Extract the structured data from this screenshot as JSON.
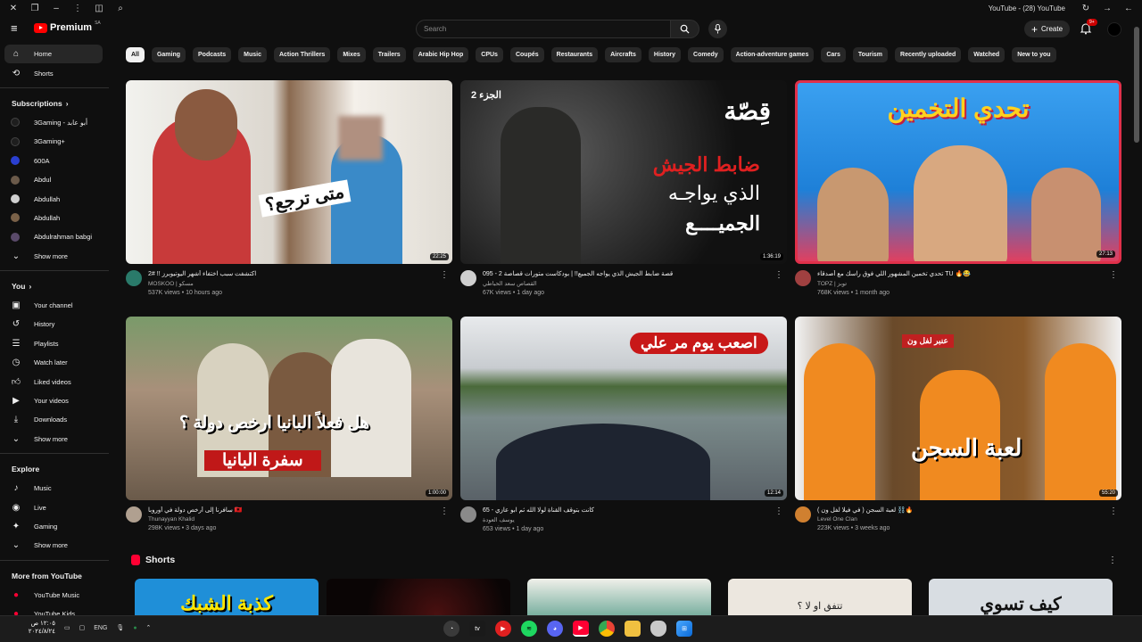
{
  "browser": {
    "title": "YouTube - (28) YouTube"
  },
  "masthead": {
    "logo_text": "Premium",
    "logo_sup": "SA",
    "search_placeholder": "Search",
    "create_label": "Create",
    "notif_count": "9+"
  },
  "sidebar": {
    "main": [
      {
        "label": "Home",
        "icon": "home-icon"
      },
      {
        "label": "Shorts",
        "icon": "shorts-icon"
      }
    ],
    "subscriptions_title": "Subscriptions",
    "subscriptions": [
      {
        "label": "3Gaming - أبو عابد",
        "color": "#1e1e1e"
      },
      {
        "label": "3Gaming+",
        "color": "#1e1e1e"
      },
      {
        "label": "600A",
        "color": "#2a3fd0"
      },
      {
        "label": "Abdul",
        "color": "#6b5a4a"
      },
      {
        "label": "Abdullah",
        "color": "#d0d0d0"
      },
      {
        "label": "Abdullah",
        "color": "#7a6148"
      },
      {
        "label": "Abdulrahman babgi",
        "color": "#5a4a6a"
      }
    ],
    "show_more": "Show more",
    "you_title": "You",
    "you": [
      {
        "label": "Your channel",
        "icon": "channel-icon"
      },
      {
        "label": "History",
        "icon": "history-icon"
      },
      {
        "label": "Playlists",
        "icon": "playlists-icon"
      },
      {
        "label": "Watch later",
        "icon": "watch-later-icon"
      },
      {
        "label": "Liked videos",
        "icon": "like-icon"
      },
      {
        "label": "Your videos",
        "icon": "your-videos-icon"
      },
      {
        "label": "Downloads",
        "icon": "download-icon"
      }
    ],
    "explore_title": "Explore",
    "explore": [
      {
        "label": "Music",
        "icon": "music-icon"
      },
      {
        "label": "Live",
        "icon": "live-icon"
      },
      {
        "label": "Gaming",
        "icon": "gaming-icon"
      }
    ],
    "more_title": "More from YouTube",
    "more": [
      {
        "label": "YouTube Music",
        "icon": "yt-music-icon"
      },
      {
        "label": "YouTube Kids",
        "icon": "yt-kids-icon"
      }
    ]
  },
  "chips": [
    "All",
    "Gaming",
    "Podcasts",
    "Music",
    "Action Thrillers",
    "Mixes",
    "Trailers",
    "Arabic Hip Hop",
    "CPUs",
    "Coupés",
    "Restaurants",
    "Aircrafts",
    "History",
    "Comedy",
    "Action-adventure games",
    "Cars",
    "Tourism",
    "Recently uploaded",
    "Watched",
    "New to you"
  ],
  "videos": [
    {
      "title": "اكتشفت سبب اختفاء أشهر اليوتيوبرز !! #2",
      "channel": "MOSKOO | مسكو",
      "stats": "537K views • 10 hours ago",
      "duration": "22:25",
      "thumb_text": "متى ترجع؟",
      "av_color": "#2a7a6a",
      "bg1": "#8fb8d8",
      "bg2": "#c04848"
    },
    {
      "title": "095 - 2 قصة ضابط الجيش الذي يواجه الجميع!! | بودكاست متورات قصاصة",
      "channel": "القصاص سعد الحباطي",
      "stats": "67K views • 1 day ago",
      "duration": "1:36:19",
      "thumb_text": "ضابط الجيش",
      "thumb_text2": "الذي يواجـه",
      "thumb_text3": "الجميــــع",
      "thumb_text4": "قِصّة",
      "thumb_text5": "الجزء 2",
      "av_color": "#cfcfcf",
      "bg1": "#1a1a1a",
      "bg2": "#3a3a3a"
    },
    {
      "title": "تحدي تخمين المشهور اللي فوق راسك مع أصدقاء TU 🔥😂",
      "channel": "TOPZ | توبز",
      "stats": "768K views • 1 month ago",
      "duration": "27:13",
      "thumb_text": "تحدي التخمين",
      "av_color": "#a04040",
      "bg1": "#2a8ae0",
      "bg2": "#e03050"
    },
    {
      "title": "سافرنا إلى أرخص دولة في أوروبا 🇦🇱",
      "channel": "Thunayyan Khalid",
      "stats": "298K views • 3 days ago",
      "duration": "1:00:00",
      "thumb_text": "هل فعلاً البانيا ارخص دولة ؟",
      "thumb_text2": "سفرة البانيا",
      "av_color": "#b0a090",
      "bg1": "#6a7a5a",
      "bg2": "#c0b0a0"
    },
    {
      "title": "65 - كانت بتوقف القناة لولا الله ثم ابو عازي",
      "channel": "يوسف العودة",
      "stats": "653 views • 1 day ago",
      "duration": "12:14",
      "thumb_text": "اصعب يوم مر علي",
      "av_color": "#8a8a8a",
      "bg1": "#d8dce0",
      "bg2": "#5a6268"
    },
    {
      "title": "لعبة السجن ( في فيلا لفل ون ) ⛓️🔥",
      "channel": "Level One Clan",
      "stats": "223K views • 3 weeks ago",
      "duration": "55:20",
      "thumb_text": "لعبة السجن",
      "thumb_text2": "عنبر لفل ون",
      "av_color": "#d08030",
      "bg1": "#f08a20",
      "bg2": "#7a4a20"
    }
  ],
  "shorts": {
    "title": "Shorts",
    "items": [
      {
        "text": "كذبة الشبك",
        "bg": "#1f8fd8",
        "fg": "#ffe600"
      },
      {
        "text": "",
        "bg": "#120808",
        "fg": "#ffffff"
      },
      {
        "text": "",
        "bg": "#7ab0a0",
        "fg": "#ffffff"
      },
      {
        "text": "تتفق او لا ؟",
        "bg": "#ece7df",
        "fg": "#222222"
      },
      {
        "text": "كيف تسوي",
        "bg": "#d8dde2",
        "fg": "#111111"
      }
    ]
  },
  "taskbar": {
    "time": "١٢:٠٥ ص",
    "date": "٢٠٢٤/٨/٢٤",
    "lang": "ENG"
  }
}
